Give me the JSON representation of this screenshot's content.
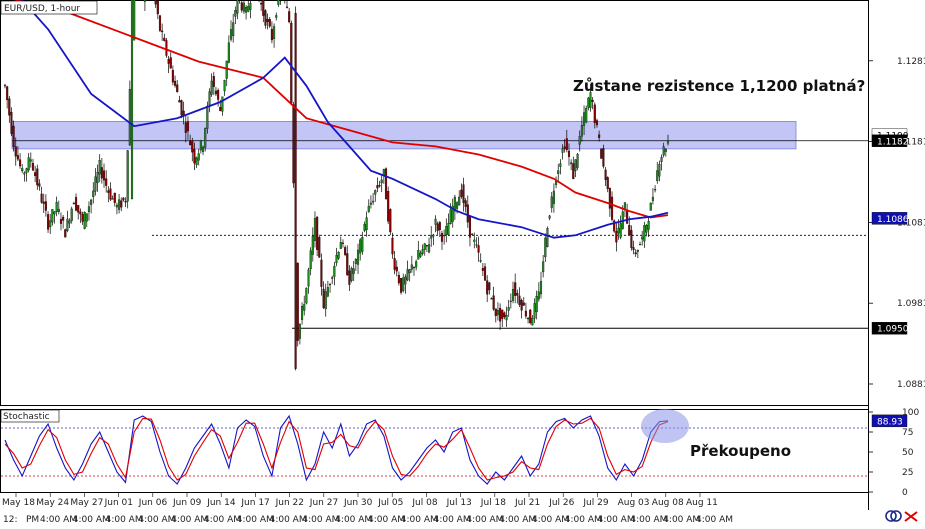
{
  "chart_data": [
    {
      "type": "candlestick",
      "title": "EUR/USD, 1-hour",
      "ylim": [
        1.0855,
        1.1355
      ],
      "y_ticks": [
        1.0881,
        1.0981,
        1.1081,
        1.1181,
        1.1281
      ],
      "y_tick_labels": [
        "1.0881",
        "1.0981",
        "1.1081",
        "1.1181",
        "1.1281"
      ],
      "x_categories": [
        "May 18",
        "May 24",
        "May 27",
        "Jun 01",
        "Jun 06",
        "Jun 09",
        "Jun 14",
        "Jun 17",
        "Jun 22",
        "Jun 27",
        "Jun 30",
        "Jul 05",
        "Jul 08",
        "Jul 13",
        "Jul 18",
        "Jul 21",
        "Jul 26",
        "Jul 29",
        "Aug 03",
        "Aug 08",
        "Aug 11"
      ],
      "x_time_labels": [
        "12:",
        "PM",
        "4:00 AM",
        "4:00 AM",
        "4:00 AM",
        "4:00 AM",
        "4:00 AM",
        "4:00 AM",
        "4:00 AM",
        "4:00 AM",
        "4:00 AM",
        "4:00 AM",
        "4:00 AM",
        "4:00 AM",
        "4:00 AM",
        "4:00 AM",
        "4:00 AM",
        "4:00 AM",
        "4:00 AM",
        "4:00 AM",
        "4:00 AM",
        "4:00 AM",
        "4:00 AM"
      ],
      "price_path": [
        [
          0,
          1.125
        ],
        [
          4,
          1.118
        ],
        [
          8,
          1.114
        ],
        [
          12,
          1.116
        ],
        [
          16,
          1.112
        ],
        [
          20,
          1.108
        ],
        [
          24,
          1.11
        ],
        [
          28,
          1.107
        ],
        [
          32,
          1.111
        ],
        [
          36,
          1.108
        ],
        [
          40,
          1.111
        ],
        [
          44,
          1.115
        ],
        [
          48,
          1.112
        ],
        [
          52,
          1.11
        ],
        [
          56,
          1.111
        ],
        [
          60,
          1.138
        ],
        [
          64,
          1.136
        ],
        [
          68,
          1.138
        ],
        [
          72,
          1.132
        ],
        [
          76,
          1.128
        ],
        [
          80,
          1.124
        ],
        [
          84,
          1.12
        ],
        [
          88,
          1.116
        ],
        [
          92,
          1.118
        ],
        [
          96,
          1.126
        ],
        [
          100,
          1.122
        ],
        [
          104,
          1.13
        ],
        [
          108,
          1.136
        ],
        [
          112,
          1.134
        ],
        [
          116,
          1.138
        ],
        [
          120,
          1.134
        ],
        [
          124,
          1.131
        ],
        [
          128,
          1.138
        ],
        [
          132,
          1.133
        ],
        [
          136,
          1.094
        ],
        [
          140,
          1.1
        ],
        [
          144,
          1.108
        ],
        [
          148,
          1.098
        ],
        [
          152,
          1.102
        ],
        [
          156,
          1.106
        ],
        [
          160,
          1.101
        ],
        [
          164,
          1.104
        ],
        [
          168,
          1.109
        ],
        [
          172,
          1.112
        ],
        [
          176,
          1.114
        ],
        [
          180,
          1.104
        ],
        [
          184,
          1.1
        ],
        [
          188,
          1.102
        ],
        [
          192,
          1.104
        ],
        [
          196,
          1.105
        ],
        [
          200,
          1.108
        ],
        [
          204,
          1.106
        ],
        [
          208,
          1.11
        ],
        [
          212,
          1.112
        ],
        [
          216,
          1.107
        ],
        [
          220,
          1.104
        ],
        [
          224,
          1.1
        ],
        [
          228,
          1.097
        ],
        [
          232,
          1.096
        ],
        [
          236,
          1.1
        ],
        [
          240,
          1.098
        ],
        [
          244,
          1.096
        ],
        [
          248,
          1.099
        ],
        [
          252,
          1.108
        ],
        [
          256,
          1.114
        ],
        [
          260,
          1.118
        ],
        [
          264,
          1.114
        ],
        [
          268,
          1.12
        ],
        [
          272,
          1.124
        ],
        [
          276,
          1.118
        ],
        [
          280,
          1.112
        ],
        [
          284,
          1.106
        ],
        [
          288,
          1.11
        ],
        [
          292,
          1.104
        ],
        [
          296,
          1.106
        ],
        [
          300,
          1.11
        ],
        [
          304,
          1.116
        ],
        [
          308,
          1.1182
        ]
      ],
      "series": [
        {
          "name": "",
          "color": "#e00000",
          "values": [
            [
              0,
              1.136
            ],
            [
              30,
              1.134
            ],
            [
              60,
              1.131
            ],
            [
              90,
              1.128
            ],
            [
              120,
              1.126
            ],
            [
              140,
              1.121
            ],
            [
              160,
              1.1195
            ],
            [
              180,
              1.118
            ],
            [
              200,
              1.1175
            ],
            [
              220,
              1.1165
            ],
            [
              240,
              1.115
            ],
            [
              255,
              1.1135
            ],
            [
              265,
              1.1118
            ],
            [
              280,
              1.1105
            ],
            [
              290,
              1.1095
            ],
            [
              300,
              1.1087
            ],
            [
              308,
              1.109
            ]
          ]
        },
        {
          "name": "",
          "color": "#1515c8",
          "values": [
            [
              0,
              1.138
            ],
            [
              20,
              1.132
            ],
            [
              40,
              1.124
            ],
            [
              60,
              1.12
            ],
            [
              80,
              1.121
            ],
            [
              100,
              1.123
            ],
            [
              120,
              1.126
            ],
            [
              130,
              1.1285
            ],
            [
              140,
              1.125
            ],
            [
              150,
              1.1205
            ],
            [
              160,
              1.1175
            ],
            [
              170,
              1.1145
            ],
            [
              180,
              1.1135
            ],
            [
              200,
              1.111
            ],
            [
              210,
              1.1095
            ],
            [
              220,
              1.1085
            ],
            [
              240,
              1.1075
            ],
            [
              255,
              1.1062
            ],
            [
              265,
              1.1065
            ],
            [
              280,
              1.1078
            ],
            [
              290,
              1.1085
            ],
            [
              300,
              1.1088
            ],
            [
              308,
              1.1093
            ]
          ]
        }
      ],
      "resistance_zone": [
        1.1172,
        1.1206
      ],
      "levels": [
        {
          "value": 1.1182,
          "style": "solid",
          "label": "1.1182"
        },
        {
          "value": 1.119,
          "style": "label",
          "label": "1.1190"
        },
        {
          "value": 1.1065,
          "style": "dotted",
          "label": ""
        },
        {
          "value": 1.095,
          "style": "solid",
          "label": "1.0950"
        }
      ],
      "last_price": {
        "value": 1.1182,
        "label": "1.1182"
      },
      "blue_line_label": {
        "value": 1.1086,
        "label": "1.1086"
      },
      "annotation": "Zůstane rezistence 1,1200 platná?"
    },
    {
      "type": "line",
      "title": "Stochastic",
      "ylim": [
        0,
        100
      ],
      "y_ticks": [
        0,
        25,
        50,
        75,
        100
      ],
      "y_tick_labels": [
        "0",
        "25",
        "50",
        "75",
        "100"
      ],
      "levels": [
        80,
        20
      ],
      "last_value": {
        "value": 88.93,
        "label": "88.93"
      },
      "annotation": "Překoupeno",
      "series": [
        {
          "name": "",
          "color": "#1515c8",
          "values": [
            [
              0,
              65
            ],
            [
              4,
              40
            ],
            [
              8,
              20
            ],
            [
              12,
              45
            ],
            [
              16,
              70
            ],
            [
              20,
              85
            ],
            [
              24,
              55
            ],
            [
              28,
              30
            ],
            [
              32,
              15
            ],
            [
              36,
              35
            ],
            [
              40,
              60
            ],
            [
              44,
              75
            ],
            [
              48,
              50
            ],
            [
              52,
              25
            ],
            [
              56,
              12
            ],
            [
              60,
              90
            ],
            [
              64,
              95
            ],
            [
              68,
              88
            ],
            [
              72,
              50
            ],
            [
              76,
              20
            ],
            [
              80,
              10
            ],
            [
              84,
              30
            ],
            [
              88,
              55
            ],
            [
              92,
              70
            ],
            [
              96,
              85
            ],
            [
              100,
              60
            ],
            [
              104,
              30
            ],
            [
              108,
              80
            ],
            [
              112,
              90
            ],
            [
              116,
              82
            ],
            [
              120,
              45
            ],
            [
              124,
              20
            ],
            [
              128,
              80
            ],
            [
              132,
              95
            ],
            [
              136,
              60
            ],
            [
              140,
              15
            ],
            [
              144,
              35
            ],
            [
              148,
              75
            ],
            [
              152,
              55
            ],
            [
              156,
              85
            ],
            [
              160,
              45
            ],
            [
              164,
              60
            ],
            [
              168,
              85
            ],
            [
              172,
              90
            ],
            [
              176,
              70
            ],
            [
              180,
              30
            ],
            [
              184,
              15
            ],
            [
              188,
              25
            ],
            [
              192,
              40
            ],
            [
              196,
              55
            ],
            [
              200,
              65
            ],
            [
              204,
              50
            ],
            [
              208,
              75
            ],
            [
              212,
              80
            ],
            [
              216,
              40
            ],
            [
              220,
              20
            ],
            [
              224,
              10
            ],
            [
              228,
              25
            ],
            [
              232,
              15
            ],
            [
              236,
              30
            ],
            [
              240,
              45
            ],
            [
              244,
              20
            ],
            [
              248,
              35
            ],
            [
              252,
              75
            ],
            [
              256,
              88
            ],
            [
              260,
              92
            ],
            [
              264,
              80
            ],
            [
              268,
              90
            ],
            [
              272,
              95
            ],
            [
              276,
              70
            ],
            [
              280,
              30
            ],
            [
              284,
              15
            ],
            [
              288,
              35
            ],
            [
              292,
              20
            ],
            [
              296,
              40
            ],
            [
              300,
              75
            ],
            [
              304,
              88
            ],
            [
              308,
              89
            ]
          ]
        },
        {
          "name": "",
          "color": "#e00000",
          "values": [
            [
              0,
              60
            ],
            [
              4,
              48
            ],
            [
              8,
              30
            ],
            [
              12,
              35
            ],
            [
              16,
              58
            ],
            [
              20,
              78
            ],
            [
              24,
              68
            ],
            [
              28,
              40
            ],
            [
              32,
              22
            ],
            [
              36,
              25
            ],
            [
              40,
              48
            ],
            [
              44,
              68
            ],
            [
              48,
              60
            ],
            [
              52,
              35
            ],
            [
              56,
              18
            ],
            [
              60,
              75
            ],
            [
              64,
              92
            ],
            [
              68,
              91
            ],
            [
              72,
              65
            ],
            [
              76,
              32
            ],
            [
              80,
              15
            ],
            [
              84,
              22
            ],
            [
              88,
              45
            ],
            [
              92,
              62
            ],
            [
              96,
              78
            ],
            [
              100,
              70
            ],
            [
              104,
              42
            ],
            [
              108,
              62
            ],
            [
              112,
              86
            ],
            [
              116,
              86
            ],
            [
              120,
              60
            ],
            [
              124,
              30
            ],
            [
              128,
              62
            ],
            [
              132,
              88
            ],
            [
              136,
              75
            ],
            [
              140,
              30
            ],
            [
              144,
              28
            ],
            [
              148,
              60
            ],
            [
              152,
              62
            ],
            [
              156,
              72
            ],
            [
              160,
              58
            ],
            [
              164,
              55
            ],
            [
              168,
              75
            ],
            [
              172,
              88
            ],
            [
              176,
              78
            ],
            [
              180,
              45
            ],
            [
              184,
              22
            ],
            [
              188,
              20
            ],
            [
              192,
              32
            ],
            [
              196,
              48
            ],
            [
              200,
              60
            ],
            [
              204,
              56
            ],
            [
              208,
              66
            ],
            [
              212,
              78
            ],
            [
              216,
              55
            ],
            [
              220,
              30
            ],
            [
              224,
              15
            ],
            [
              228,
              18
            ],
            [
              232,
              20
            ],
            [
              236,
              25
            ],
            [
              240,
              38
            ],
            [
              244,
              30
            ],
            [
              248,
              28
            ],
            [
              252,
              60
            ],
            [
              256,
              82
            ],
            [
              260,
              90
            ],
            [
              264,
              85
            ],
            [
              268,
              86
            ],
            [
              272,
              92
            ],
            [
              276,
              80
            ],
            [
              280,
              45
            ],
            [
              284,
              22
            ],
            [
              288,
              28
            ],
            [
              292,
              25
            ],
            [
              296,
              32
            ],
            [
              300,
              62
            ],
            [
              304,
              84
            ],
            [
              308,
              88
            ]
          ]
        }
      ]
    }
  ]
}
